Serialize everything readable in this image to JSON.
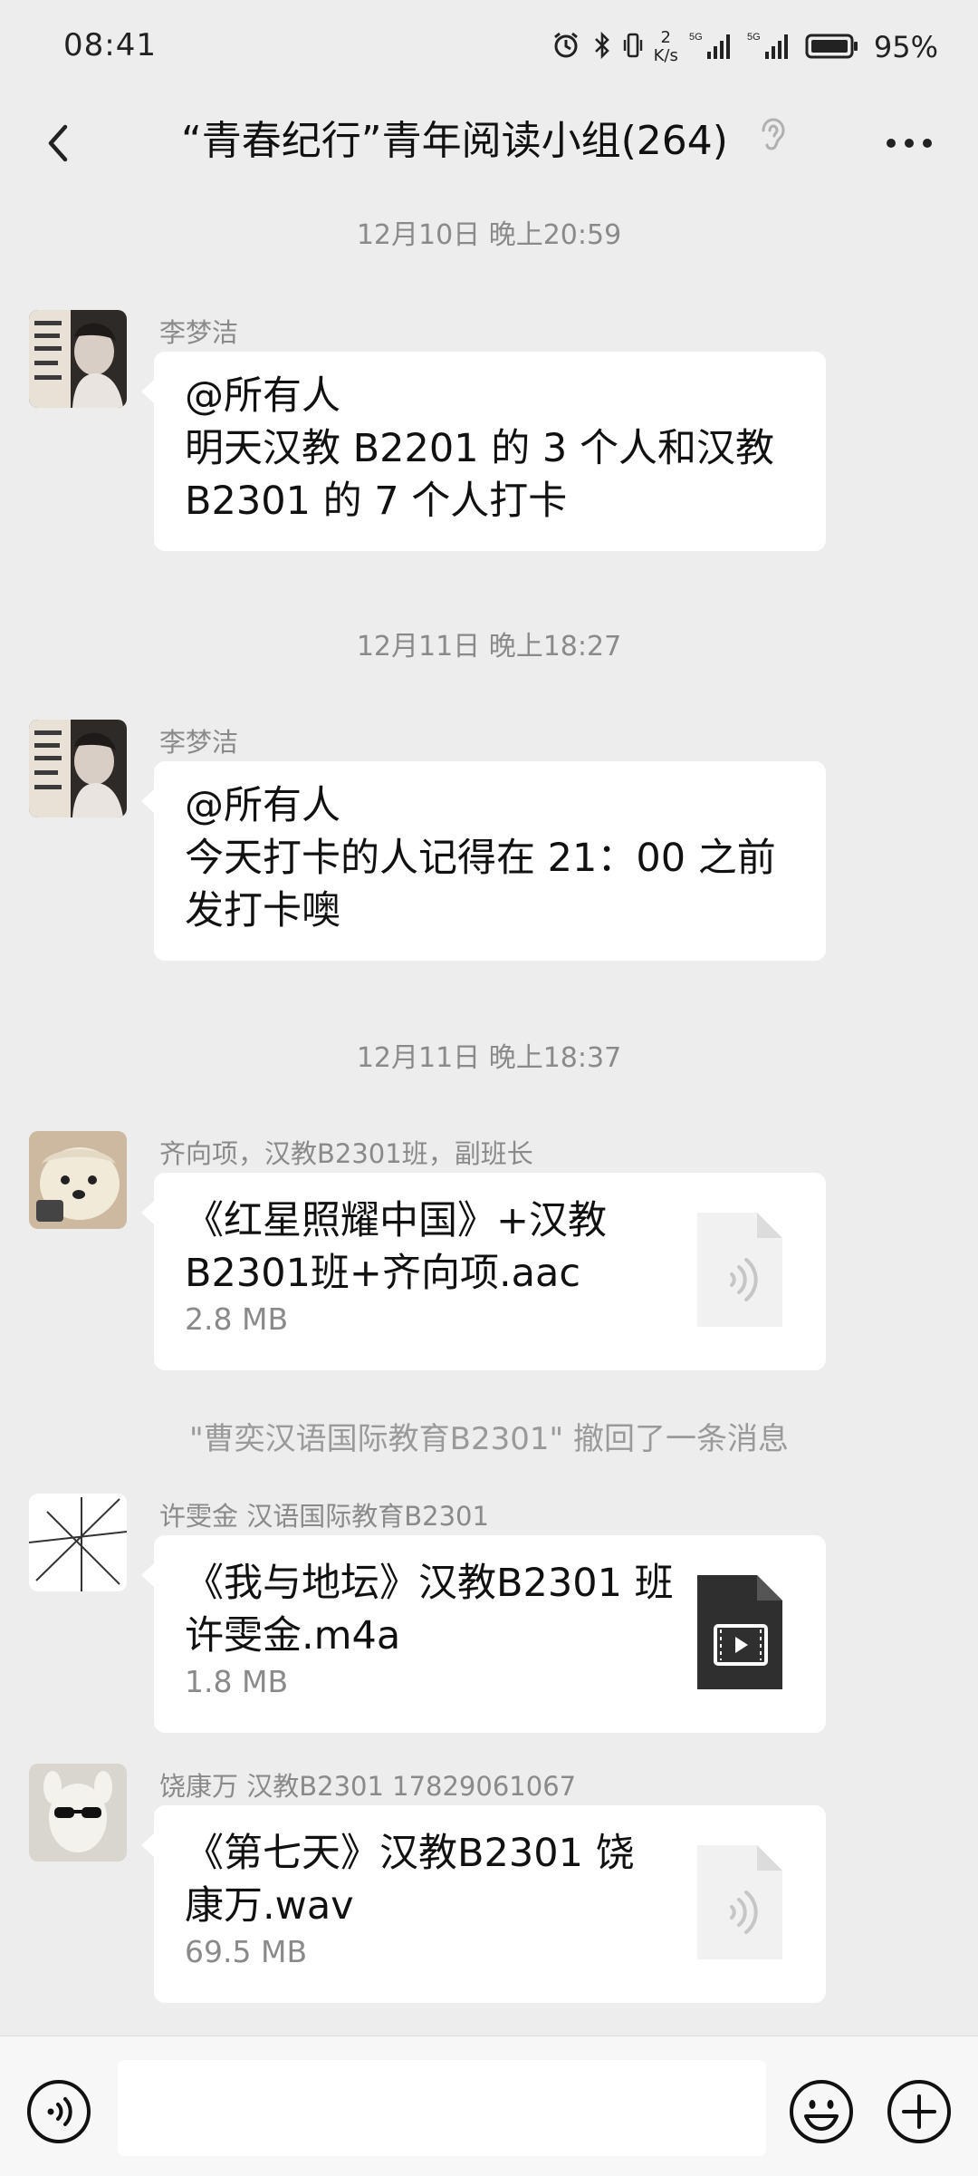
{
  "status_bar": {
    "time": "08:41",
    "net_speed_value": "2",
    "net_speed_unit": "K/s",
    "signal_1_label": "5G",
    "signal_2_label": "5G",
    "battery": "95%"
  },
  "nav": {
    "title": "“青春纪行”青年阅读小组(264)"
  },
  "messages": [
    {
      "timestamp": "12月10日 晚上20:59"
    },
    {
      "sender": "李梦洁",
      "lines": [
        "@所有人",
        "明天汉教 B2201 的 3 个人和汉教",
        "B2301 的 7 个人打卡"
      ]
    },
    {
      "timestamp": "12月11日 晚上18:27"
    },
    {
      "sender": "李梦洁",
      "lines": [
        "@所有人",
        "今天打卡的人记得在 21：00 之前",
        "发打卡噢"
      ]
    },
    {
      "timestamp": "12月11日 晚上18:37"
    },
    {
      "sender": "齐向项，汉教B2301班，副班长",
      "file_lines": [
        "《红星照耀中国》+汉教",
        "B2301班+齐向项.aac"
      ],
      "file_size": "2.8 MB",
      "file_icon": "audio-file-icon"
    },
    {
      "recall": "\"曹奕汉语国际教育B2301\" 撤回了一条消息"
    },
    {
      "sender": "许雯金 汉语国际教育B2301",
      "file_lines": [
        "《我与地坛》汉教B2301 班",
        "许雯金.m4a"
      ],
      "file_size": "1.8 MB",
      "file_icon": "video-file-icon"
    },
    {
      "sender": "饶康万 汉教B2301 17829061067",
      "file_lines": [
        "《第七天》汉教B2301 饶",
        "康万.wav"
      ],
      "file_size": "69.5 MB",
      "file_icon": "audio-file-icon"
    }
  ],
  "colors": {
    "background": "#ededed",
    "bubble": "#ffffff",
    "muted_text": "#8a8a8a"
  }
}
